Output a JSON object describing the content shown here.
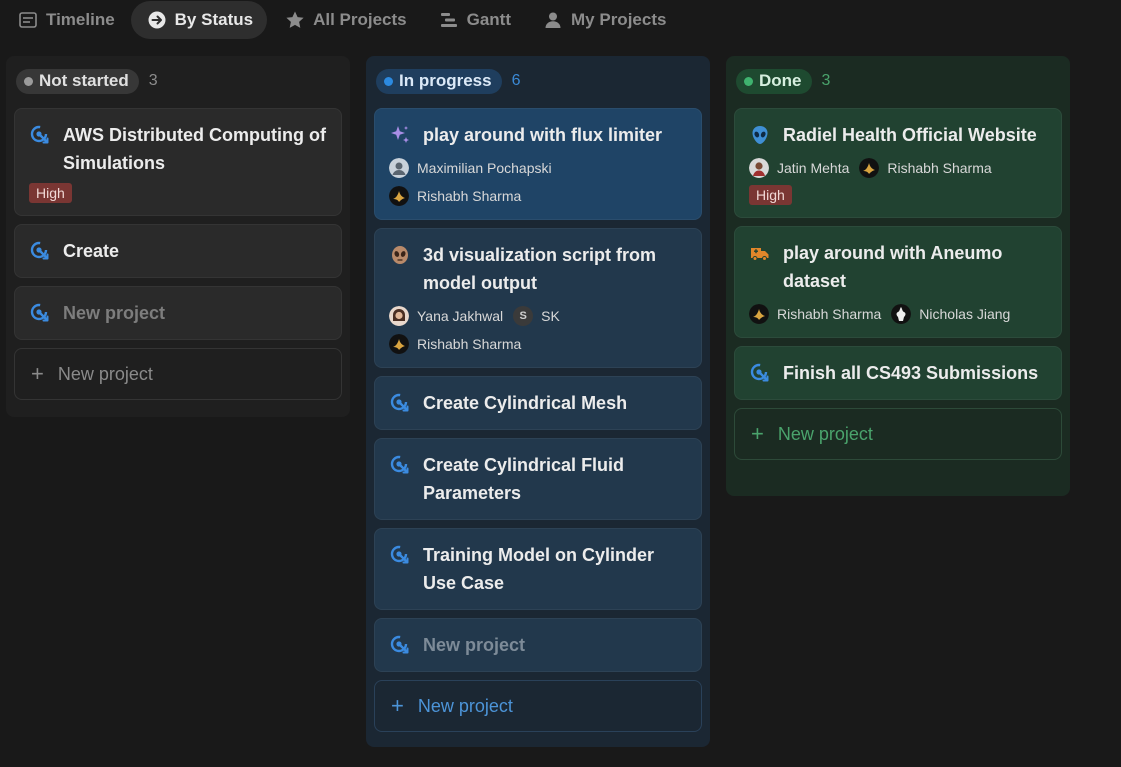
{
  "tabs": [
    {
      "label": "Timeline",
      "icon": "timeline-icon",
      "active": false
    },
    {
      "label": "By Status",
      "icon": "arrow-circle-icon",
      "active": true
    },
    {
      "label": "All Projects",
      "icon": "star-icon",
      "active": false
    },
    {
      "label": "Gantt",
      "icon": "gantt-icon",
      "active": false
    },
    {
      "label": "My Projects",
      "icon": "person-icon",
      "active": false
    }
  ],
  "columns": {
    "not_started": {
      "label": "Not started",
      "count": "3",
      "color": "#9b9b9b",
      "cards": [
        {
          "title": "AWS Distributed Computing of Simulations",
          "icon": "project-icon",
          "priority": "High"
        },
        {
          "title": "Create",
          "icon": "project-icon"
        },
        {
          "title": "New project",
          "icon": "project-icon"
        }
      ],
      "new_label": "New project"
    },
    "in_progress": {
      "label": "In progress",
      "count": "6",
      "color": "#2c8ae0",
      "cards": [
        {
          "title": "play around with flux limiter",
          "icon": "sparkles-icon",
          "people": [
            "Maximilian Pochapski",
            "Rishabh Sharma"
          ]
        },
        {
          "title": "3d visualization script from model output",
          "icon": "alien-face-icon",
          "people": [
            "Yana Jakhwal",
            "SK",
            "Rishabh Sharma"
          ],
          "sk_initial": "S"
        },
        {
          "title": "Create Cylindrical Mesh",
          "icon": "project-icon"
        },
        {
          "title": "Create Cylindrical Fluid Parameters",
          "icon": "project-icon"
        },
        {
          "title": "Training Model on Cylinder Use Case",
          "icon": "project-icon"
        },
        {
          "title": "New project",
          "icon": "project-icon"
        }
      ],
      "new_label": "New project"
    },
    "done": {
      "label": "Done",
      "count": "3",
      "color": "#3fb36f",
      "cards": [
        {
          "title": "Radiel Health Official Website",
          "icon": "alien-icon",
          "people": [
            "Jatin Mehta",
            "Rishabh Sharma"
          ],
          "priority": "High"
        },
        {
          "title": "play around with Aneumo dataset",
          "icon": "ambulance-icon",
          "people": [
            "Rishabh Sharma",
            "Nicholas Jiang"
          ]
        },
        {
          "title": "Finish all CS493 Submissions",
          "icon": "project-icon"
        }
      ],
      "new_label": "New project"
    }
  }
}
